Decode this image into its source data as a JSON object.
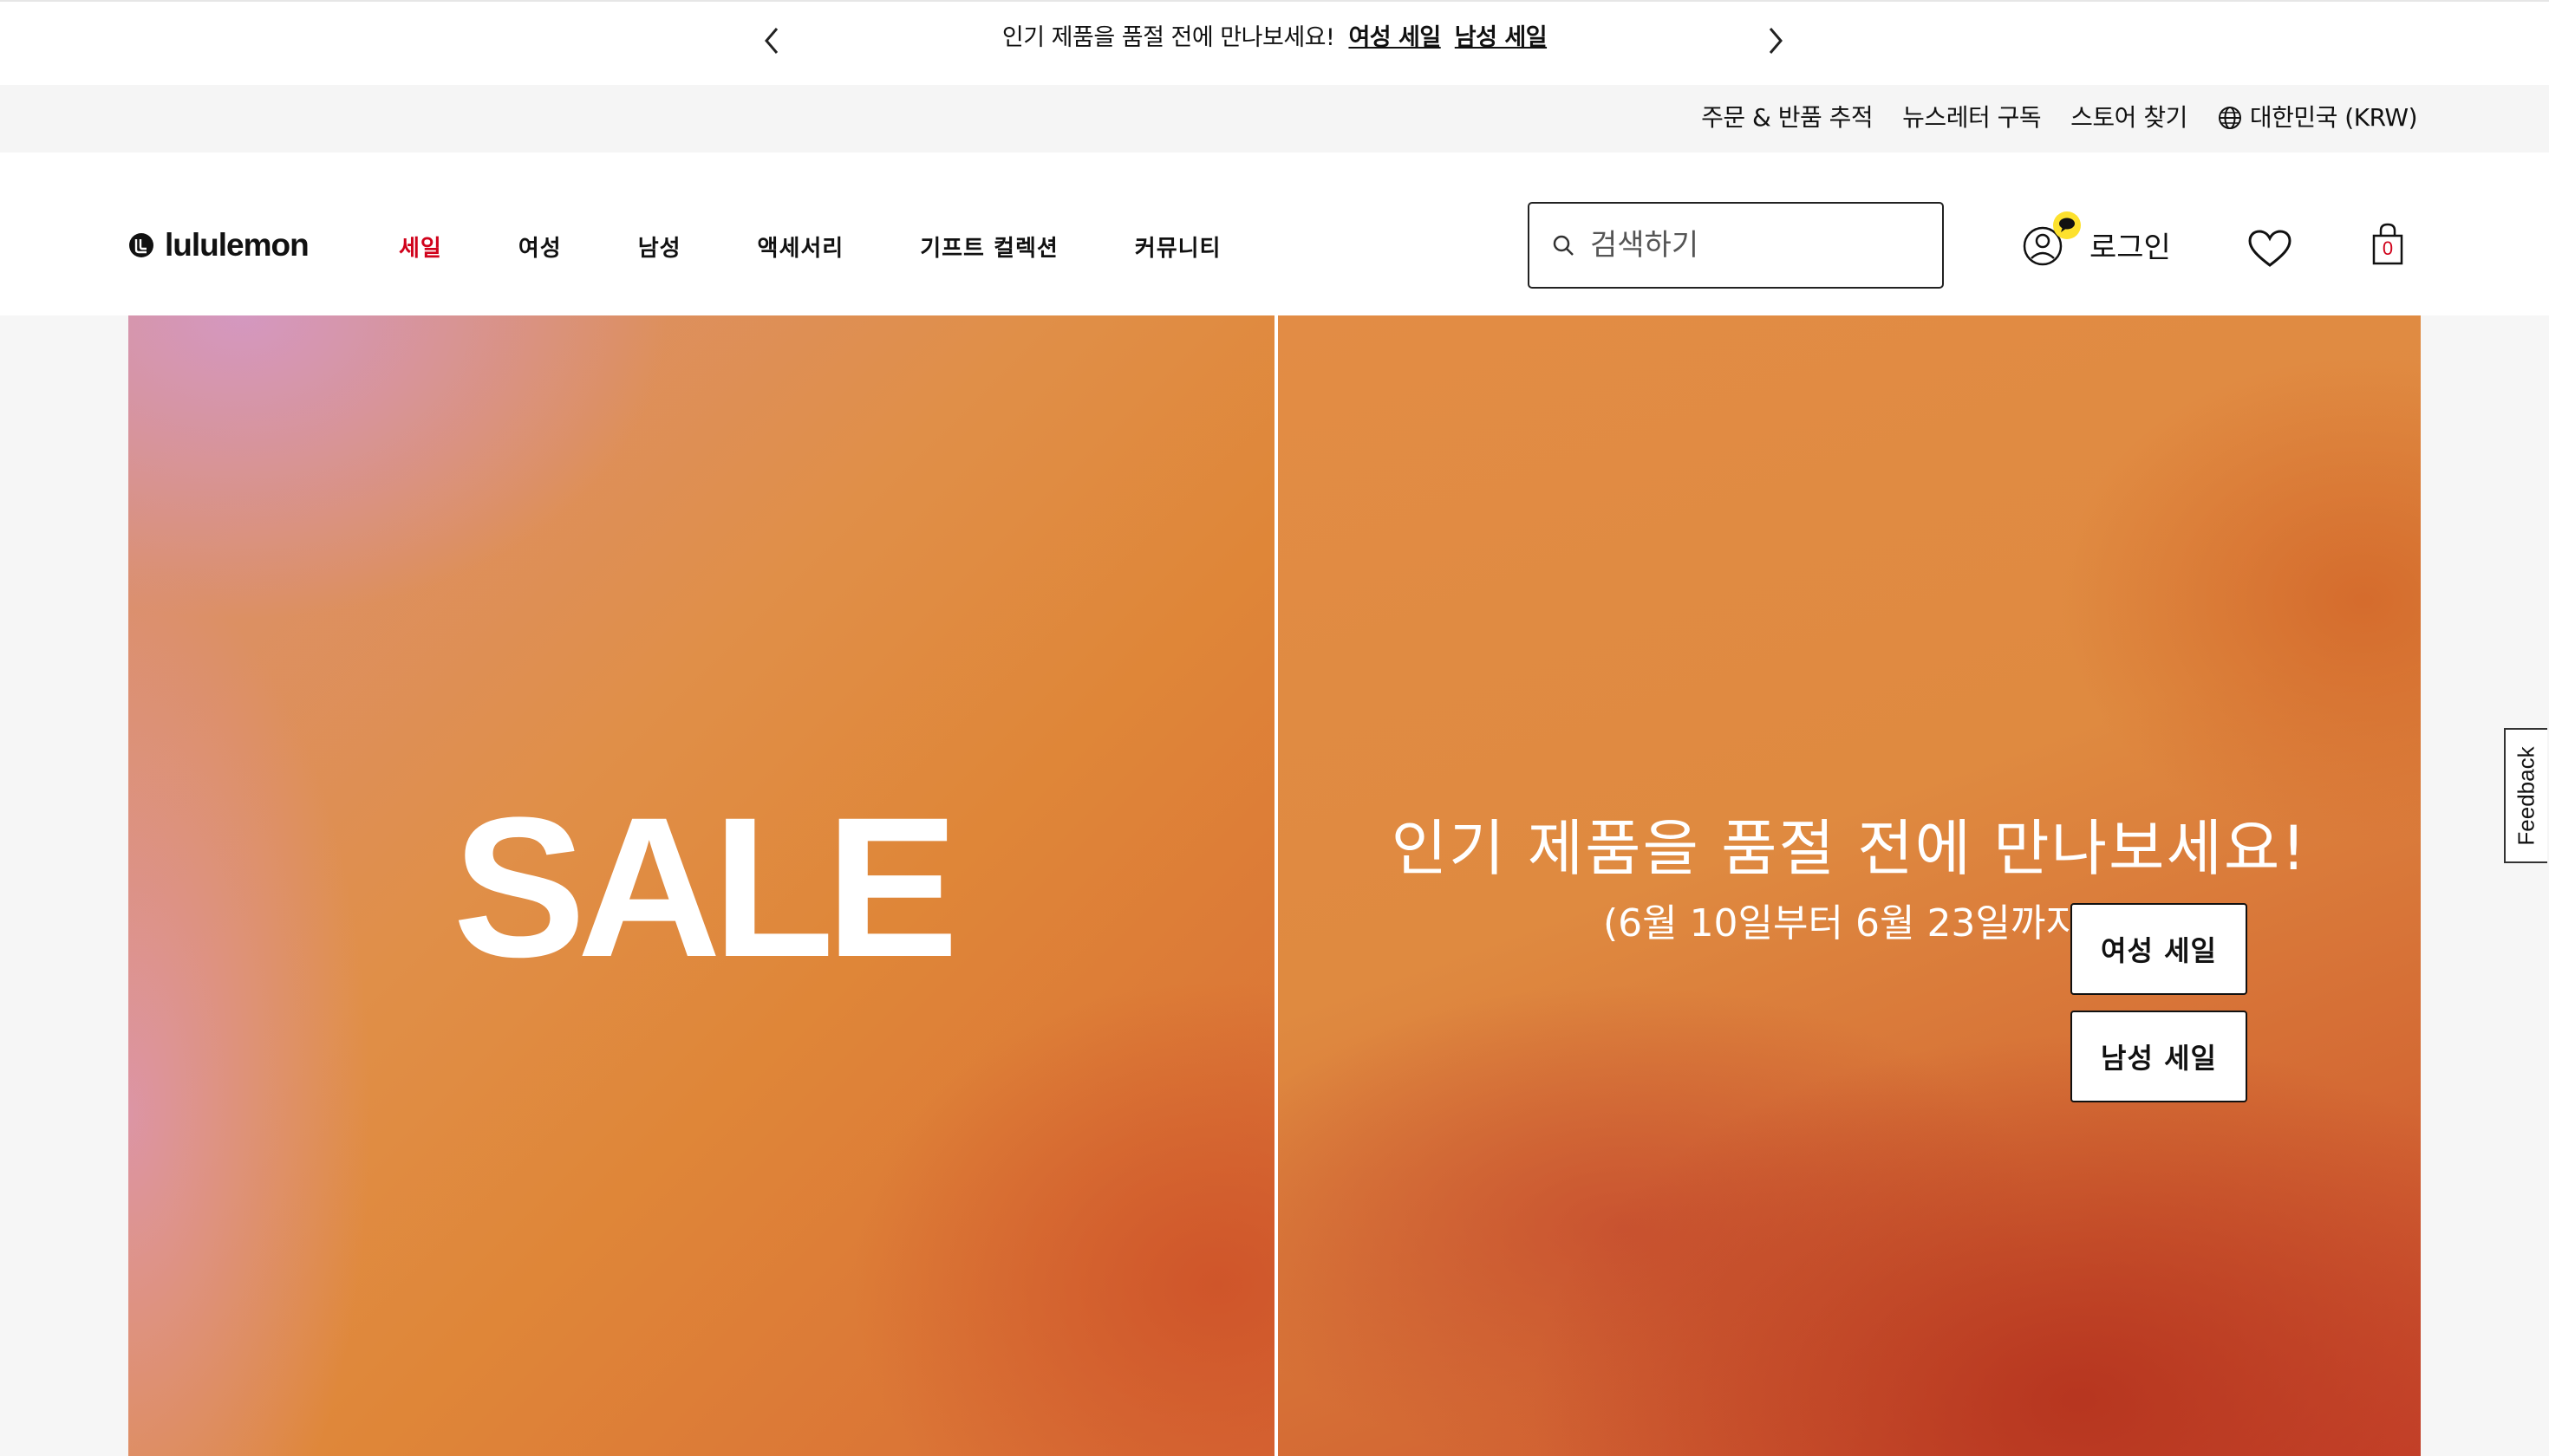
{
  "announcement": {
    "message": "인기 제품을 품절 전에 만나보세요!",
    "women_link": "여성 세일",
    "men_link": "남성 세일"
  },
  "utility": {
    "order_tracking": "주문 & 반품 추적",
    "newsletter": "뉴스레터 구독",
    "store_locator": "스토어 찾기",
    "region": "대한민국 (KRW)"
  },
  "header": {
    "logo_text": "lululemon",
    "nav": {
      "sale": "세일",
      "women": "여성",
      "men": "남성",
      "accessories": "액세서리",
      "gift": "기프트 컬렉션",
      "community": "커뮤니티"
    },
    "search_placeholder": "검색하기",
    "login": "로그인",
    "bag_count": "0"
  },
  "hero": {
    "sale_word": "SALE",
    "headline": "인기 제품을 품절 전에 만나보세요!",
    "subline": "(6월 10일부터 6월 23일까지)",
    "cta_women": "여성 세일",
    "cta_men": "남성 세일"
  },
  "feedback": "Feedback",
  "colors": {
    "sale_accent": "#d0021b",
    "notification_dot": "#fde12d"
  }
}
